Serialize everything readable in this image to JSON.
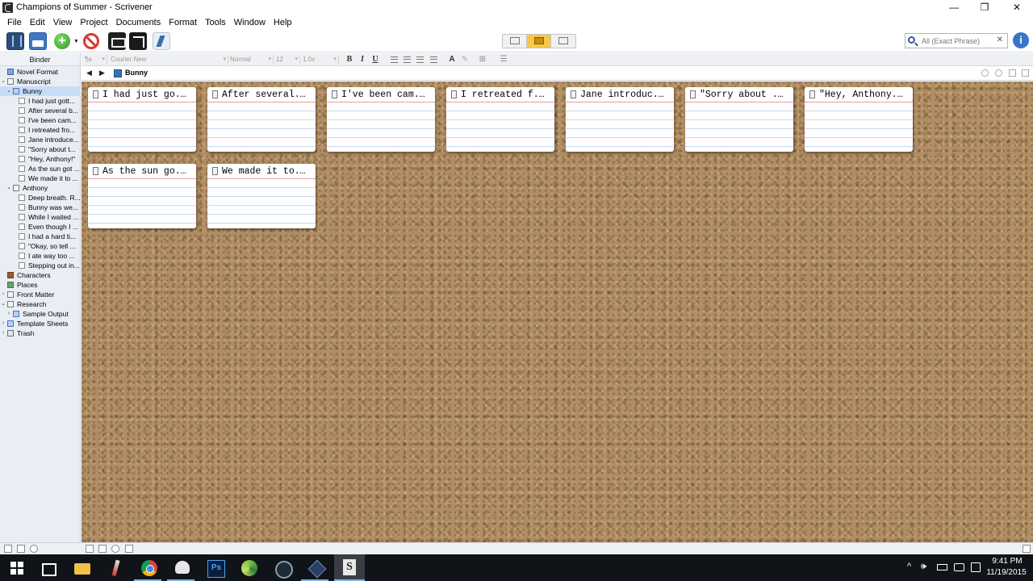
{
  "window": {
    "title": "Champions of Summer - Scrivener",
    "minimize": "—",
    "restore": "❐",
    "close": "✕"
  },
  "menu": [
    "File",
    "Edit",
    "View",
    "Project",
    "Documents",
    "Format",
    "Tools",
    "Window",
    "Help"
  ],
  "search": {
    "placeholder": "All (Exact Phrase)",
    "value": "",
    "clear": "✕"
  },
  "help_label": "i",
  "binder": {
    "header": "Binder",
    "items": [
      {
        "label": "Novel Format",
        "depth": 0,
        "icon": "book",
        "twisty": ""
      },
      {
        "label": "Manuscript",
        "depth": 0,
        "icon": "folder",
        "twisty": "⌄"
      },
      {
        "label": "Bunny",
        "depth": 1,
        "icon": "folder-blue",
        "twisty": "⌄",
        "selected": true
      },
      {
        "label": "I had just gott...",
        "depth": 2,
        "icon": "doc",
        "twisty": ""
      },
      {
        "label": "After several b...",
        "depth": 2,
        "icon": "doc",
        "twisty": ""
      },
      {
        "label": "I've been cam...",
        "depth": 2,
        "icon": "doc",
        "twisty": ""
      },
      {
        "label": "I retreated fro...",
        "depth": 2,
        "icon": "doc",
        "twisty": ""
      },
      {
        "label": "Jane introduce...",
        "depth": 2,
        "icon": "doc",
        "twisty": ""
      },
      {
        "label": "\"Sorry about t...",
        "depth": 2,
        "icon": "doc",
        "twisty": ""
      },
      {
        "label": "\"Hey, Anthony!\"",
        "depth": 2,
        "icon": "doc",
        "twisty": ""
      },
      {
        "label": "As the sun got ...",
        "depth": 2,
        "icon": "doc",
        "twisty": ""
      },
      {
        "label": "We made it to ...",
        "depth": 2,
        "icon": "doc",
        "twisty": ""
      },
      {
        "label": "Anthony",
        "depth": 1,
        "icon": "folder",
        "twisty": "⌄"
      },
      {
        "label": "Deep breath. R...",
        "depth": 2,
        "icon": "doc",
        "twisty": ""
      },
      {
        "label": "Bunny was we...",
        "depth": 2,
        "icon": "doc",
        "twisty": ""
      },
      {
        "label": "While I waited ...",
        "depth": 2,
        "icon": "doc",
        "twisty": ""
      },
      {
        "label": "Even though I ...",
        "depth": 2,
        "icon": "doc",
        "twisty": ""
      },
      {
        "label": "I had a hard ti...",
        "depth": 2,
        "icon": "doc",
        "twisty": ""
      },
      {
        "label": "\"Okay, so tell ...",
        "depth": 2,
        "icon": "doc",
        "twisty": ""
      },
      {
        "label": "I ate way too ...",
        "depth": 2,
        "icon": "doc",
        "twisty": ""
      },
      {
        "label": "Stepping out in...",
        "depth": 2,
        "icon": "doc",
        "twisty": ""
      },
      {
        "label": "Characters",
        "depth": 0,
        "icon": "char",
        "twisty": ""
      },
      {
        "label": "Places",
        "depth": 0,
        "icon": "place",
        "twisty": ""
      },
      {
        "label": "Front Matter",
        "depth": 0,
        "icon": "folder",
        "twisty": "›"
      },
      {
        "label": "Research",
        "depth": 0,
        "icon": "folder",
        "twisty": "⌄"
      },
      {
        "label": "Sample Output",
        "depth": 1,
        "icon": "folder-blue",
        "twisty": "›"
      },
      {
        "label": "Template Sheets",
        "depth": 0,
        "icon": "folder-blue",
        "twisty": "›"
      },
      {
        "label": "Trash",
        "depth": 0,
        "icon": "trash",
        "twisty": "›"
      }
    ]
  },
  "format_bar": {
    "style": "¶a",
    "font": "Courier New",
    "weight": "Normal",
    "size": "12",
    "spacing": "1.0x",
    "bold": "B",
    "italic": "I",
    "underline": "U"
  },
  "header": {
    "back": "◀",
    "forward": "▶",
    "title": "Bunny"
  },
  "cards": [
    "I had just go...",
    "After several...",
    "I've been cam...",
    "I retreated f...",
    "Jane introduc...",
    "\"Sorry about ...",
    "\"Hey, Anthony...",
    "As the sun go...",
    "We made it to..."
  ],
  "taskbar": {
    "time": "9:41 PM",
    "date": "11/19/2015",
    "tray_up": "^",
    "volume": "🕪"
  }
}
